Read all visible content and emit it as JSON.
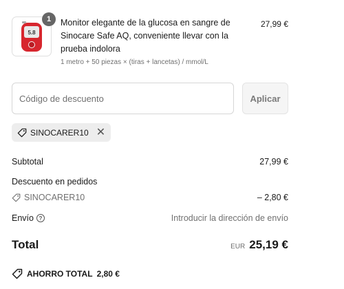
{
  "product": {
    "quantity": "1",
    "title": "Monitor elegante de la glucosa en sangre de Sinocare Safe AQ, conveniente llevar con la prueba indolora",
    "variant": "1 metro + 50 piezas × (tiras + lancetas) / mmol/L",
    "price": "27,99 €",
    "device_screen": "5.8"
  },
  "discount": {
    "placeholder": "Código de descuento",
    "apply_label": "Aplicar",
    "applied_code": "SINOCARER10"
  },
  "summary": {
    "subtotal_label": "Subtotal",
    "subtotal_value": "27,99 €",
    "order_discount_label": "Descuento en pedidos",
    "discount_code": "SINOCARER10",
    "discount_value": "– 2,80 €",
    "shipping_label": "Envío",
    "shipping_value": "Introducir la dirección de envío",
    "total_label": "Total",
    "currency": "EUR",
    "total_value": "25,19 €",
    "savings_label": "AHORRO TOTAL",
    "savings_value": "2,80 €"
  },
  "icons": {
    "tag": "tag-icon",
    "close": "close-icon",
    "help": "question-circle-icon",
    "savings": "savings-tag-icon"
  },
  "colors": {
    "device_red": "#d7262e",
    "badge": "#666666",
    "chip_bg": "#ededed"
  }
}
